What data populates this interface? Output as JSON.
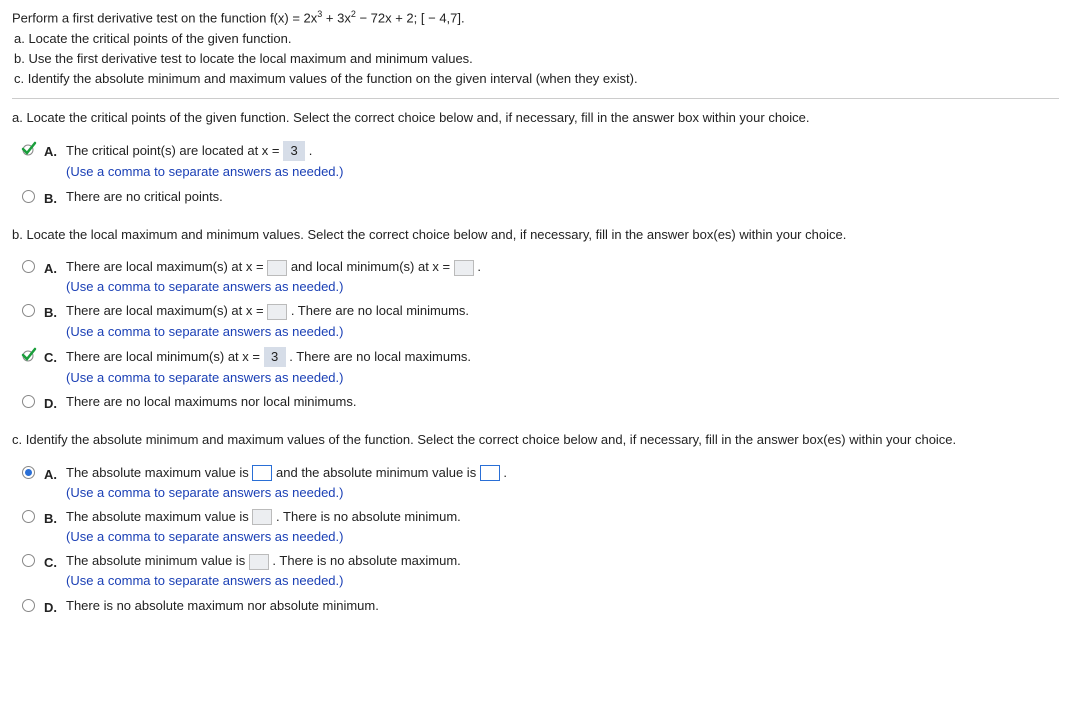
{
  "header": {
    "main": "Perform a first derivative test on the function f(x) = 2x",
    "exp1": "3",
    "mid1": " + 3x",
    "exp2": "2",
    "tail": " − 72x + 2; [ − 4,7].",
    "a": "a. Locate the critical points of the given function.",
    "b": "b. Use the first derivative test to locate the local maximum and minimum values.",
    "c": "c. Identify the absolute minimum and maximum values of the function on the given interval (when they exist)."
  },
  "partA": {
    "prompt": "a. Locate the critical points of the given function. Select the correct choice below and, if necessary, fill in the answer box within your choice.",
    "optA_pre": "The critical point(s) are located at x = ",
    "optA_val": "3",
    "optA_post": " .",
    "hint": "(Use a comma to separate answers as needed.)",
    "optB": "There are no critical points."
  },
  "partB": {
    "prompt": "b. Locate the local maximum and minimum values. Select the correct choice below and, if necessary, fill in the answer box(es) within your choice.",
    "optA_1": "There are local maximum(s) at x = ",
    "optA_2": " and local minimum(s) at x = ",
    "optA_3": " .",
    "optB_1": "There are local maximum(s) at x = ",
    "optB_2": " . There are no local minimums.",
    "optC_1": "There are local minimum(s) at x = ",
    "optC_val": "3",
    "optC_2": " . There are no local maximums.",
    "optD": "There are no local maximums nor local minimums.",
    "hint": "(Use a comma to separate answers as needed.)"
  },
  "partC": {
    "prompt": "c. Identify the absolute minimum and maximum values of the function. Select the correct choice below and, if necessary, fill in the answer box(es) within your choice.",
    "optA_1": "The absolute maximum value is ",
    "optA_2": " and the absolute minimum value is ",
    "optA_3": " .",
    "optB_1": "The absolute maximum value is ",
    "optB_2": " . There is no absolute minimum.",
    "optC_1": "The absolute minimum value is ",
    "optC_2": " . There is no absolute maximum.",
    "optD": "There is no absolute maximum nor absolute minimum.",
    "hint": "(Use a comma to separate answers as needed.)"
  },
  "labels": {
    "A": "A.",
    "B": "B.",
    "C": "C.",
    "D": "D."
  }
}
